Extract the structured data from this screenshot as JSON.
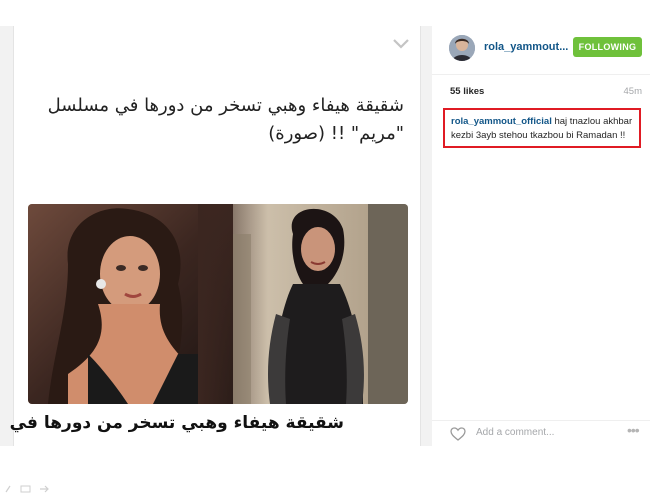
{
  "post": {
    "headline": "شقيقة هيفاء وهبي تسخر من دورها في مسلسل \"مريم\" !! (صورة)",
    "photo_caption": "شقيقة هيفاء وهبي تسخر من دورها في"
  },
  "sidebar": {
    "username": "rola_yammout...",
    "follow_label": "FOLLOWING",
    "likes": "55 likes",
    "time": "45m",
    "comment": {
      "user": "rola_yammout_official",
      "text": "haj tnazlou akhbar kezbi 3ayb stehou tkazbou bi Ramadan !!"
    },
    "add_comment_placeholder": "Add a comment...",
    "more": "•••"
  },
  "colors": {
    "follow_green": "#6fc13b",
    "username_blue": "#125688",
    "highlight_red": "#e01b24"
  },
  "icons": [
    "chevron-down-icon",
    "heart-icon",
    "more-options-icon"
  ]
}
